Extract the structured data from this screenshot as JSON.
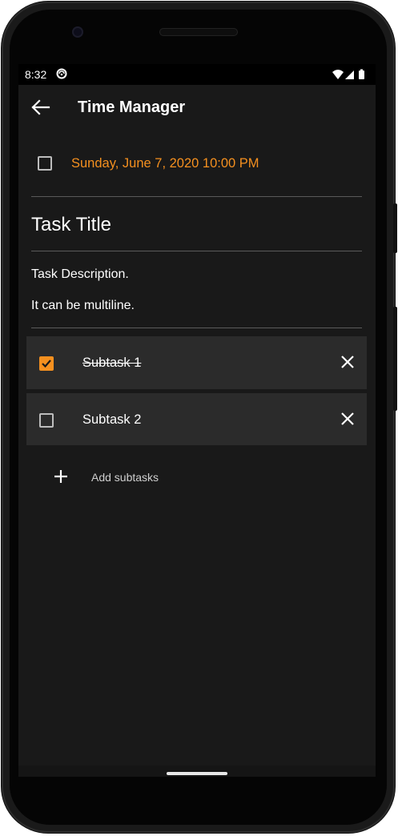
{
  "status_bar": {
    "time": "8:32"
  },
  "app_bar": {
    "title": "Time Manager"
  },
  "task": {
    "due_date": "Sunday, June 7, 2020 10:00 PM",
    "title": "Task Title",
    "description_line_1": "Task Description.",
    "description_line_2": "It can be multiline."
  },
  "subtasks": [
    {
      "label": "Subtask 1",
      "checked": true
    },
    {
      "label": "Subtask 2",
      "checked": false
    }
  ],
  "add_subtasks_label": "Add subtasks",
  "colors": {
    "accent": "#f5901f",
    "background": "#191919",
    "subtask_bg": "#2b2b2b"
  },
  "icons": [
    "back-arrow-icon",
    "checkbox-icon",
    "close-icon",
    "plus-icon",
    "wifi-icon",
    "signal-icon",
    "battery-icon"
  ]
}
